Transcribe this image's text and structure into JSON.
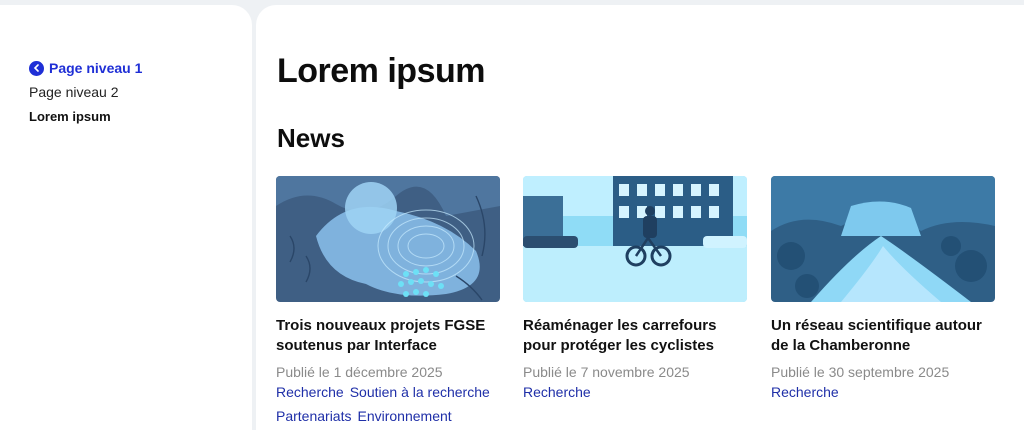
{
  "sidebar": {
    "items": [
      {
        "label": "Page niveau 1"
      },
      {
        "label": "Page niveau 2"
      },
      {
        "label": "Lorem ipsum"
      }
    ]
  },
  "main": {
    "page_title": "Lorem ipsum",
    "section_title": "News",
    "cards": [
      {
        "title": "Trois nouveaux projets FGSE soutenus par Interface",
        "date": "Publié le 1 décembre 2025",
        "tags": [
          "Recherche",
          "Soutien à la recherche",
          "Partenariats",
          "Environnement"
        ]
      },
      {
        "title": "Réaménager les carrefours pour protéger les cyclistes",
        "date": "Publié le 7 novembre 2025",
        "tags": [
          "Recherche"
        ]
      },
      {
        "title": "Un réseau scientifique autour de la Chamberonne",
        "date": "Publié le 30 septembre 2025",
        "tags": [
          "Recherche"
        ]
      }
    ]
  },
  "colors": {
    "accent": "#1f2fd6",
    "tag": "#1f2fa8",
    "date": "#8a8a8a",
    "background": "#eef1f4"
  },
  "icons": [
    "chevron-left-icon"
  ]
}
